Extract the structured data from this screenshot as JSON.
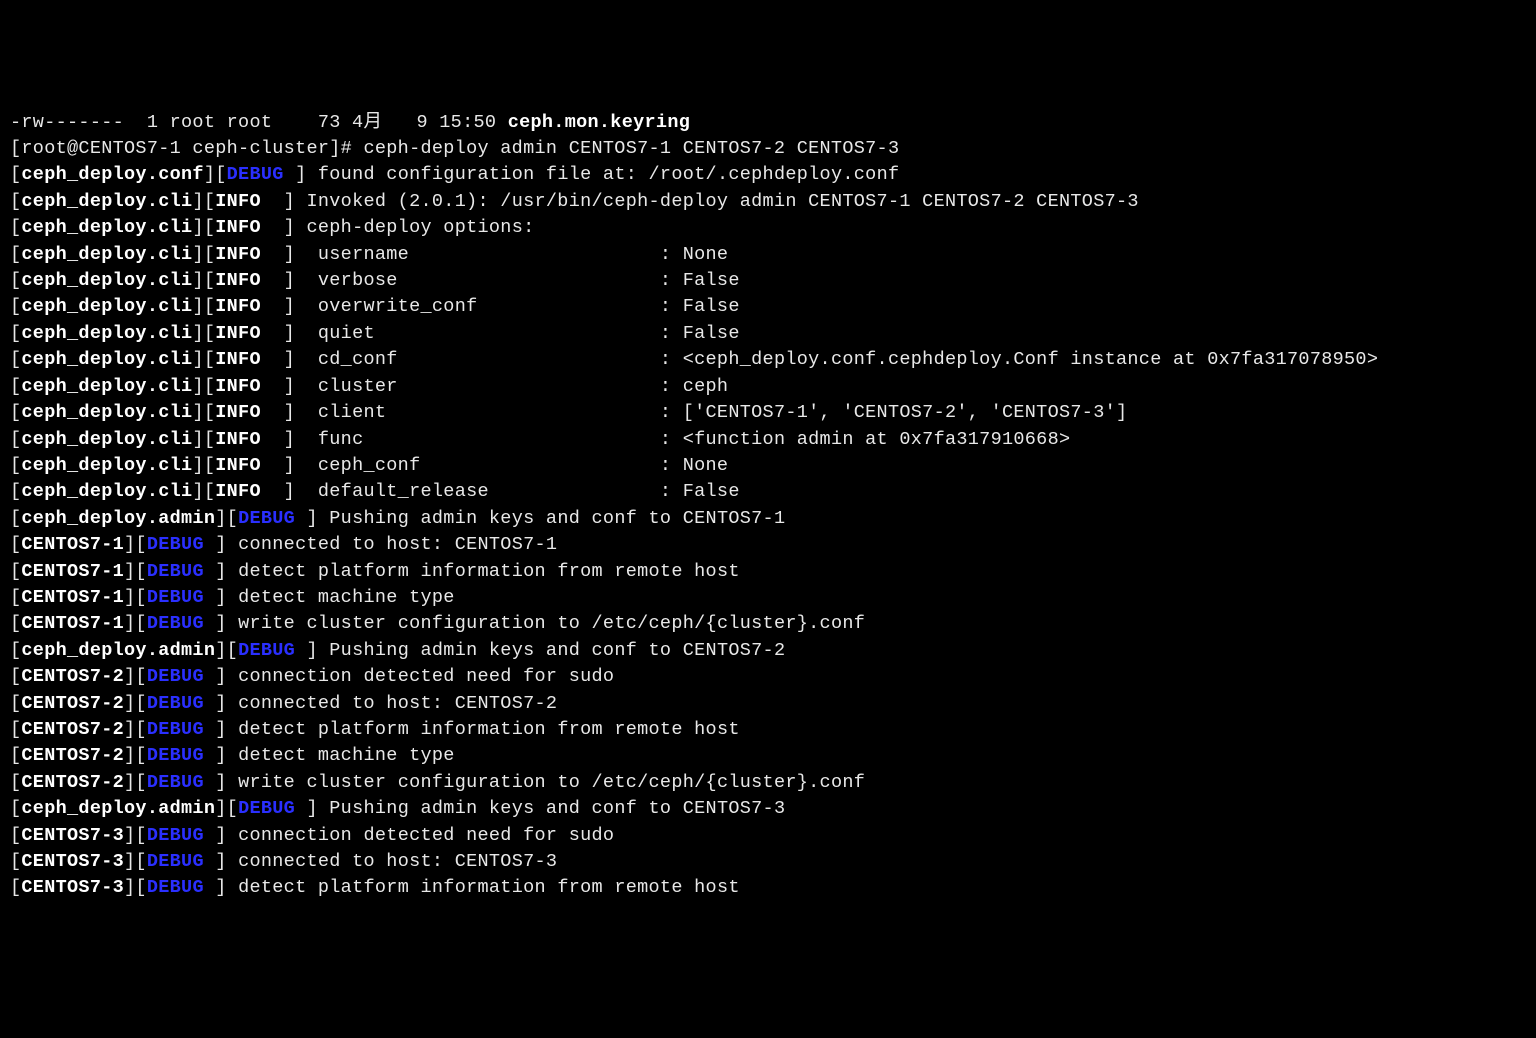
{
  "lines": [
    {
      "segments": [
        {
          "cls": "",
          "text": "-rw-------  1 root root    73 4月   9 15:50 "
        },
        {
          "cls": "bold",
          "text": "ceph.mon.keyring"
        }
      ]
    },
    {
      "segments": [
        {
          "cls": "",
          "text": "[root@CENTOS7-1 ceph-cluster]# ceph-deploy admin CENTOS7-1 CENTOS7-2 CENTOS7-3"
        }
      ]
    },
    {
      "segments": [
        {
          "cls": "",
          "text": "["
        },
        {
          "cls": "bold",
          "text": "ceph_deploy.conf"
        },
        {
          "cls": "",
          "text": "]["
        },
        {
          "cls": "debug",
          "text": "DEBUG"
        },
        {
          "cls": "",
          "text": " ] found configuration file at: /root/.cephdeploy.conf"
        }
      ]
    },
    {
      "segments": [
        {
          "cls": "",
          "text": "["
        },
        {
          "cls": "bold",
          "text": "ceph_deploy.cli"
        },
        {
          "cls": "",
          "text": "]["
        },
        {
          "cls": "info",
          "text": "INFO"
        },
        {
          "cls": "",
          "text": "  ] Invoked (2.0.1): /usr/bin/ceph-deploy admin CENTOS7-1 CENTOS7-2 CENTOS7-3"
        }
      ]
    },
    {
      "segments": [
        {
          "cls": "",
          "text": "["
        },
        {
          "cls": "bold",
          "text": "ceph_deploy.cli"
        },
        {
          "cls": "",
          "text": "]["
        },
        {
          "cls": "info",
          "text": "INFO"
        },
        {
          "cls": "",
          "text": "  ] ceph-deploy options:"
        }
      ]
    },
    {
      "segments": [
        {
          "cls": "",
          "text": "["
        },
        {
          "cls": "bold",
          "text": "ceph_deploy.cli"
        },
        {
          "cls": "",
          "text": "]["
        },
        {
          "cls": "info",
          "text": "INFO"
        },
        {
          "cls": "",
          "text": "  ]  username                      : None"
        }
      ]
    },
    {
      "segments": [
        {
          "cls": "",
          "text": "["
        },
        {
          "cls": "bold",
          "text": "ceph_deploy.cli"
        },
        {
          "cls": "",
          "text": "]["
        },
        {
          "cls": "info",
          "text": "INFO"
        },
        {
          "cls": "",
          "text": "  ]  verbose                       : False"
        }
      ]
    },
    {
      "segments": [
        {
          "cls": "",
          "text": "["
        },
        {
          "cls": "bold",
          "text": "ceph_deploy.cli"
        },
        {
          "cls": "",
          "text": "]["
        },
        {
          "cls": "info",
          "text": "INFO"
        },
        {
          "cls": "",
          "text": "  ]  overwrite_conf                : False"
        }
      ]
    },
    {
      "segments": [
        {
          "cls": "",
          "text": "["
        },
        {
          "cls": "bold",
          "text": "ceph_deploy.cli"
        },
        {
          "cls": "",
          "text": "]["
        },
        {
          "cls": "info",
          "text": "INFO"
        },
        {
          "cls": "",
          "text": "  ]  quiet                         : False"
        }
      ]
    },
    {
      "segments": [
        {
          "cls": "",
          "text": "["
        },
        {
          "cls": "bold",
          "text": "ceph_deploy.cli"
        },
        {
          "cls": "",
          "text": "]["
        },
        {
          "cls": "info",
          "text": "INFO"
        },
        {
          "cls": "",
          "text": "  ]  cd_conf                       : <ceph_deploy.conf.cephdeploy.Conf instance at 0x7fa317078950>"
        }
      ]
    },
    {
      "segments": [
        {
          "cls": "",
          "text": "["
        },
        {
          "cls": "bold",
          "text": "ceph_deploy.cli"
        },
        {
          "cls": "",
          "text": "]["
        },
        {
          "cls": "info",
          "text": "INFO"
        },
        {
          "cls": "",
          "text": "  ]  cluster                       : ceph"
        }
      ]
    },
    {
      "segments": [
        {
          "cls": "",
          "text": "["
        },
        {
          "cls": "bold",
          "text": "ceph_deploy.cli"
        },
        {
          "cls": "",
          "text": "]["
        },
        {
          "cls": "info",
          "text": "INFO"
        },
        {
          "cls": "",
          "text": "  ]  client                        : ['CENTOS7-1', 'CENTOS7-2', 'CENTOS7-3']"
        }
      ]
    },
    {
      "segments": [
        {
          "cls": "",
          "text": "["
        },
        {
          "cls": "bold",
          "text": "ceph_deploy.cli"
        },
        {
          "cls": "",
          "text": "]["
        },
        {
          "cls": "info",
          "text": "INFO"
        },
        {
          "cls": "",
          "text": "  ]  func                          : <function admin at 0x7fa317910668>"
        }
      ]
    },
    {
      "segments": [
        {
          "cls": "",
          "text": "["
        },
        {
          "cls": "bold",
          "text": "ceph_deploy.cli"
        },
        {
          "cls": "",
          "text": "]["
        },
        {
          "cls": "info",
          "text": "INFO"
        },
        {
          "cls": "",
          "text": "  ]  ceph_conf                     : None"
        }
      ]
    },
    {
      "segments": [
        {
          "cls": "",
          "text": "["
        },
        {
          "cls": "bold",
          "text": "ceph_deploy.cli"
        },
        {
          "cls": "",
          "text": "]["
        },
        {
          "cls": "info",
          "text": "INFO"
        },
        {
          "cls": "",
          "text": "  ]  default_release               : False"
        }
      ]
    },
    {
      "segments": [
        {
          "cls": "",
          "text": "["
        },
        {
          "cls": "bold",
          "text": "ceph_deploy.admin"
        },
        {
          "cls": "",
          "text": "]["
        },
        {
          "cls": "debug",
          "text": "DEBUG"
        },
        {
          "cls": "",
          "text": " ] Pushing admin keys and conf to CENTOS7-1"
        }
      ]
    },
    {
      "segments": [
        {
          "cls": "",
          "text": "["
        },
        {
          "cls": "bold",
          "text": "CENTOS7-1"
        },
        {
          "cls": "",
          "text": "]["
        },
        {
          "cls": "debug",
          "text": "DEBUG"
        },
        {
          "cls": "",
          "text": " ] connected to host: CENTOS7-1 "
        }
      ]
    },
    {
      "segments": [
        {
          "cls": "",
          "text": "["
        },
        {
          "cls": "bold",
          "text": "CENTOS7-1"
        },
        {
          "cls": "",
          "text": "]["
        },
        {
          "cls": "debug",
          "text": "DEBUG"
        },
        {
          "cls": "",
          "text": " ] detect platform information from remote host"
        }
      ]
    },
    {
      "segments": [
        {
          "cls": "",
          "text": "["
        },
        {
          "cls": "bold",
          "text": "CENTOS7-1"
        },
        {
          "cls": "",
          "text": "]["
        },
        {
          "cls": "debug",
          "text": "DEBUG"
        },
        {
          "cls": "",
          "text": " ] detect machine type"
        }
      ]
    },
    {
      "segments": [
        {
          "cls": "",
          "text": "["
        },
        {
          "cls": "bold",
          "text": "CENTOS7-1"
        },
        {
          "cls": "",
          "text": "]["
        },
        {
          "cls": "debug",
          "text": "DEBUG"
        },
        {
          "cls": "",
          "text": " ] write cluster configuration to /etc/ceph/{cluster}.conf"
        }
      ]
    },
    {
      "segments": [
        {
          "cls": "",
          "text": "["
        },
        {
          "cls": "bold",
          "text": "ceph_deploy.admin"
        },
        {
          "cls": "",
          "text": "]["
        },
        {
          "cls": "debug",
          "text": "DEBUG"
        },
        {
          "cls": "",
          "text": " ] Pushing admin keys and conf to CENTOS7-2"
        }
      ]
    },
    {
      "segments": [
        {
          "cls": "",
          "text": "["
        },
        {
          "cls": "bold",
          "text": "CENTOS7-2"
        },
        {
          "cls": "",
          "text": "]["
        },
        {
          "cls": "debug",
          "text": "DEBUG"
        },
        {
          "cls": "",
          "text": " ] connection detected need for sudo"
        }
      ]
    },
    {
      "segments": [
        {
          "cls": "",
          "text": "["
        },
        {
          "cls": "bold",
          "text": "CENTOS7-2"
        },
        {
          "cls": "",
          "text": "]["
        },
        {
          "cls": "debug",
          "text": "DEBUG"
        },
        {
          "cls": "",
          "text": " ] connected to host: CENTOS7-2 "
        }
      ]
    },
    {
      "segments": [
        {
          "cls": "",
          "text": "["
        },
        {
          "cls": "bold",
          "text": "CENTOS7-2"
        },
        {
          "cls": "",
          "text": "]["
        },
        {
          "cls": "debug",
          "text": "DEBUG"
        },
        {
          "cls": "",
          "text": " ] detect platform information from remote host"
        }
      ]
    },
    {
      "segments": [
        {
          "cls": "",
          "text": "["
        },
        {
          "cls": "bold",
          "text": "CENTOS7-2"
        },
        {
          "cls": "",
          "text": "]["
        },
        {
          "cls": "debug",
          "text": "DEBUG"
        },
        {
          "cls": "",
          "text": " ] detect machine type"
        }
      ]
    },
    {
      "segments": [
        {
          "cls": "",
          "text": "["
        },
        {
          "cls": "bold",
          "text": "CENTOS7-2"
        },
        {
          "cls": "",
          "text": "]["
        },
        {
          "cls": "debug",
          "text": "DEBUG"
        },
        {
          "cls": "",
          "text": " ] write cluster configuration to /etc/ceph/{cluster}.conf"
        }
      ]
    },
    {
      "segments": [
        {
          "cls": "",
          "text": "["
        },
        {
          "cls": "bold",
          "text": "ceph_deploy.admin"
        },
        {
          "cls": "",
          "text": "]["
        },
        {
          "cls": "debug",
          "text": "DEBUG"
        },
        {
          "cls": "",
          "text": " ] Pushing admin keys and conf to CENTOS7-3"
        }
      ]
    },
    {
      "segments": [
        {
          "cls": "",
          "text": "["
        },
        {
          "cls": "bold",
          "text": "CENTOS7-3"
        },
        {
          "cls": "",
          "text": "]["
        },
        {
          "cls": "debug",
          "text": "DEBUG"
        },
        {
          "cls": "",
          "text": " ] connection detected need for sudo"
        }
      ]
    },
    {
      "segments": [
        {
          "cls": "",
          "text": "["
        },
        {
          "cls": "bold",
          "text": "CENTOS7-3"
        },
        {
          "cls": "",
          "text": "]["
        },
        {
          "cls": "debug",
          "text": "DEBUG"
        },
        {
          "cls": "",
          "text": " ] connected to host: CENTOS7-3 "
        }
      ]
    },
    {
      "segments": [
        {
          "cls": "",
          "text": "["
        },
        {
          "cls": "bold",
          "text": "CENTOS7-3"
        },
        {
          "cls": "",
          "text": "]["
        },
        {
          "cls": "debug",
          "text": "DEBUG"
        },
        {
          "cls": "",
          "text": " ] detect platform information from remote host"
        }
      ]
    }
  ]
}
